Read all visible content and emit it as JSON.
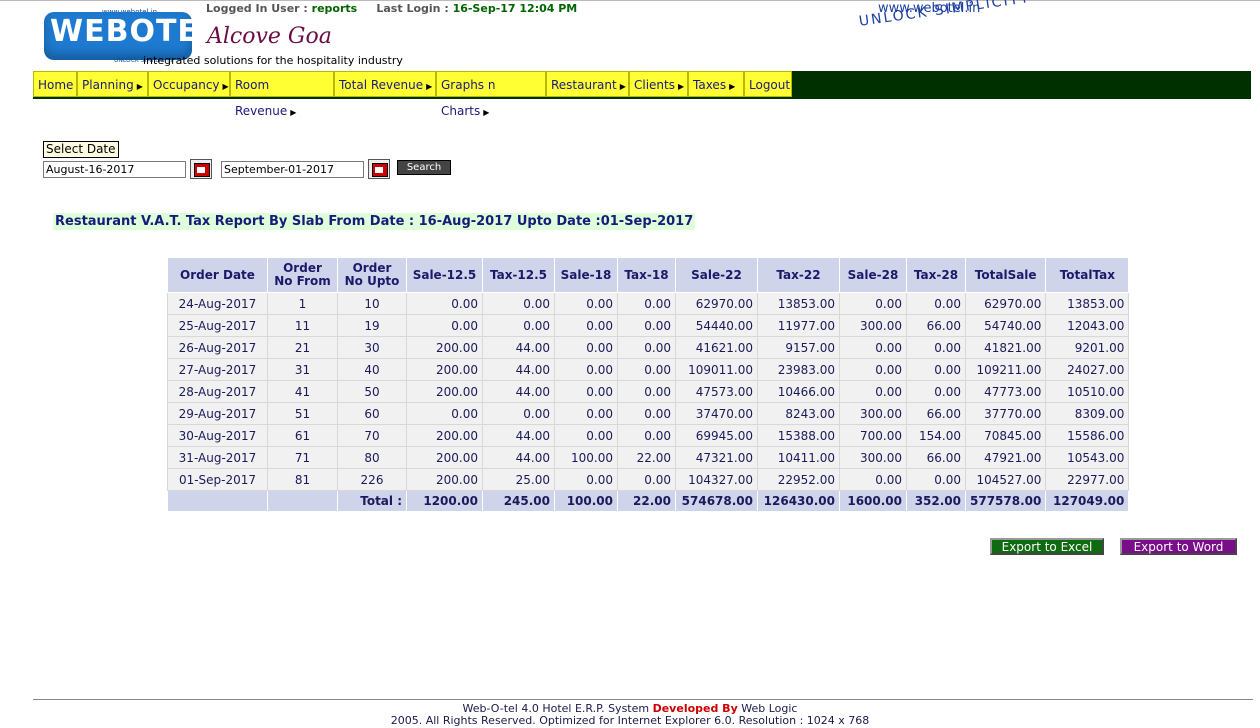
{
  "header": {
    "logo_text": "WEBOTEL",
    "logo_small_top": "www.webotel.in",
    "logo_small_bottom": "UNLOCK SIMPLICITY",
    "hotel_name": "Alcove Goa",
    "tagline": "integrated solutions for the hospitality industry",
    "logged_in_label": "Logged In User :",
    "logged_in_user": "reports",
    "last_login_label": "Last Login :",
    "last_login_value": "16-Sep-17 12:04 PM",
    "site_url": "www.webotel.in",
    "slogan": "UNLOCK SIMPLICITY"
  },
  "nav": {
    "items": [
      {
        "label": "Home",
        "submenu": false
      },
      {
        "label": "Planning",
        "submenu": true
      },
      {
        "label": "Occupancy",
        "submenu": true
      },
      {
        "label": "Room Revenue",
        "submenu": true
      },
      {
        "label": "Total Revenue",
        "submenu": true
      },
      {
        "label": "Graphs n Charts",
        "submenu": true
      },
      {
        "label": "Restaurant",
        "submenu": true
      },
      {
        "label": "Clients",
        "submenu": true
      },
      {
        "label": "Taxes",
        "submenu": true
      },
      {
        "label": "Logout",
        "submenu": false
      }
    ],
    "submenu_icon": "▶"
  },
  "date_filter": {
    "label": "Select Date",
    "from_value": "August-16-2017",
    "to_value": "September-01-2017",
    "search_label": "Search",
    "calendar_icon": "calendar-icon"
  },
  "report": {
    "title": "Restaurant V.A.T. Tax Report By Slab From Date : 16-Aug-2017 Upto Date :01-Sep-2017",
    "columns": [
      "Order Date",
      "Order No From",
      "Order No Upto",
      "Sale-12.5",
      "Tax-12.5",
      "Sale-18",
      "Tax-18",
      "Sale-22",
      "Tax-22",
      "Sale-28",
      "Tax-28",
      "TotalSale",
      "TotalTax"
    ],
    "rows": [
      [
        "24-Aug-2017",
        "1",
        "10",
        "0.00",
        "0.00",
        "0.00",
        "0.00",
        "62970.00",
        "13853.00",
        "0.00",
        "0.00",
        "62970.00",
        "13853.00"
      ],
      [
        "25-Aug-2017",
        "11",
        "19",
        "0.00",
        "0.00",
        "0.00",
        "0.00",
        "54440.00",
        "11977.00",
        "300.00",
        "66.00",
        "54740.00",
        "12043.00"
      ],
      [
        "26-Aug-2017",
        "21",
        "30",
        "200.00",
        "44.00",
        "0.00",
        "0.00",
        "41621.00",
        "9157.00",
        "0.00",
        "0.00",
        "41821.00",
        "9201.00"
      ],
      [
        "27-Aug-2017",
        "31",
        "40",
        "200.00",
        "44.00",
        "0.00",
        "0.00",
        "109011.00",
        "23983.00",
        "0.00",
        "0.00",
        "109211.00",
        "24027.00"
      ],
      [
        "28-Aug-2017",
        "41",
        "50",
        "200.00",
        "44.00",
        "0.00",
        "0.00",
        "47573.00",
        "10466.00",
        "0.00",
        "0.00",
        "47773.00",
        "10510.00"
      ],
      [
        "29-Aug-2017",
        "51",
        "60",
        "0.00",
        "0.00",
        "0.00",
        "0.00",
        "37470.00",
        "8243.00",
        "300.00",
        "66.00",
        "37770.00",
        "8309.00"
      ],
      [
        "30-Aug-2017",
        "61",
        "70",
        "200.00",
        "44.00",
        "0.00",
        "0.00",
        "69945.00",
        "15388.00",
        "700.00",
        "154.00",
        "70845.00",
        "15586.00"
      ],
      [
        "31-Aug-2017",
        "71",
        "80",
        "200.00",
        "44.00",
        "100.00",
        "22.00",
        "47321.00",
        "10411.00",
        "300.00",
        "66.00",
        "47921.00",
        "10543.00"
      ],
      [
        "01-Sep-2017",
        "81",
        "226",
        "200.00",
        "25.00",
        "0.00",
        "0.00",
        "104327.00",
        "22952.00",
        "0.00",
        "0.00",
        "104527.00",
        "22977.00"
      ]
    ],
    "total_label": "Total :",
    "totals": [
      "1200.00",
      "245.00",
      "100.00",
      "22.00",
      "574678.00",
      "126430.00",
      "1600.00",
      "352.00",
      "577578.00",
      "127049.00"
    ]
  },
  "export": {
    "excel_label": "Export to Excel",
    "word_label": "Export to Word"
  },
  "footer": {
    "line1_prefix": "Web-O-tel 4.0 Hotel E.R.P. System",
    "line1_developed": "Developed By",
    "line1_suffix": "Web Logic",
    "line2": "2005. All Rights Reserved. Optimized for Internet Explorer 6.0.  Resolution : 1024 x 768"
  },
  "colors": {
    "nav_bg": "#003000",
    "nav_item_bg": "#ffff33",
    "table_header_bg": "#d0d4ea",
    "excel_button": "#0f6b0f",
    "word_button": "#7a0d8a"
  }
}
